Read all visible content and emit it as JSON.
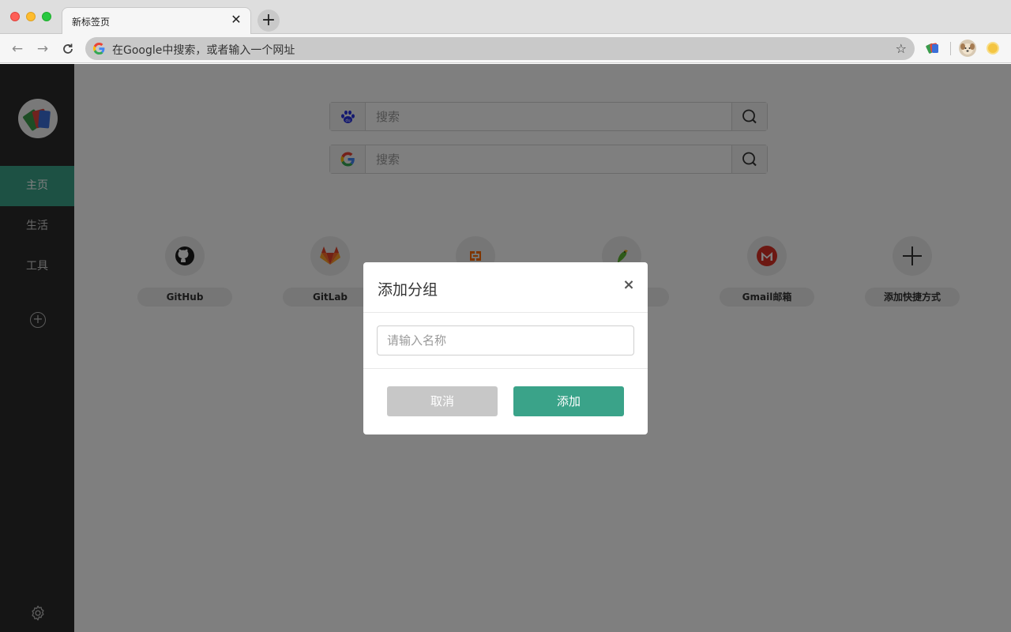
{
  "browser": {
    "tab_title": "新标签页",
    "tab_close": "✕",
    "new_tab": "+",
    "omnibox_text": "在Google中搜索，或者输入一个网址"
  },
  "sidebar": {
    "items": [
      {
        "label": "主页",
        "active": true
      },
      {
        "label": "生活",
        "active": false
      },
      {
        "label": "工具",
        "active": false
      }
    ]
  },
  "search": {
    "engines": [
      {
        "name": "baidu-icon",
        "placeholder": "搜索"
      },
      {
        "name": "google-icon",
        "placeholder": "搜索"
      }
    ]
  },
  "shortcuts": [
    {
      "label": "GitHub",
      "icon": "github-icon"
    },
    {
      "label": "GitLab",
      "icon": "gitlab-icon"
    },
    {
      "label": "",
      "icon": "aliyun-icon"
    },
    {
      "label": "",
      "icon": "parrot-icon"
    },
    {
      "label": "Gmail邮箱",
      "icon": "gmail-icon"
    },
    {
      "label": "添加快捷方式",
      "icon": "plus-icon"
    }
  ],
  "dialog": {
    "title": "添加分组",
    "close": "×",
    "input_placeholder": "请输入名称",
    "cancel_label": "取消",
    "confirm_label": "添加"
  },
  "colors": {
    "accent": "#3aa389",
    "sidebar_bg": "#2b2b2b",
    "overlay": "rgba(0,0,0,0.5)"
  }
}
